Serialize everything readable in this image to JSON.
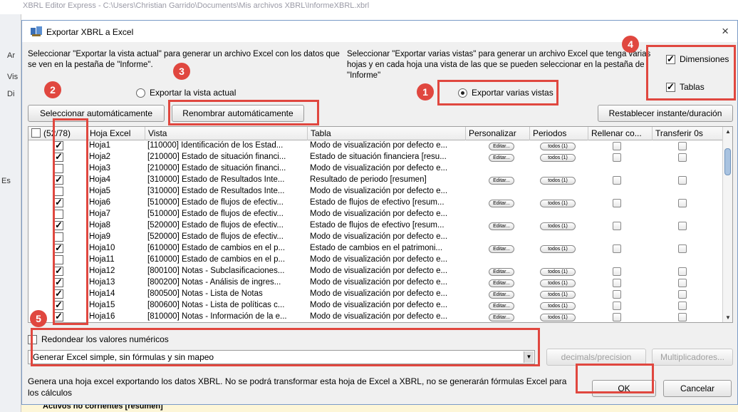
{
  "background": {
    "window_title": "XBRL Editor Express - C:\\Users\\Christian Garrido\\Documents\\Mis archivos XBRL\\InformeXBRL.xbrl",
    "left_labels": [
      "Ar",
      "Vis",
      "Di",
      "Es"
    ],
    "bottom_text": "Activos no corrientes [resumen]"
  },
  "dialog": {
    "title": "Exportar XBRL a Excel",
    "close_label": "×",
    "desc_left": "Seleccionar \"Exportar la vista actual\" para generar un archivo Excel con los datos que se ven en la pestaña de \"Informe\".",
    "desc_right": "Seleccionar \"Exportar varias vistas\" para generar un archivo Excel que tenga varias hojas y en cada hoja una vista de las que se pueden seleccionar en la pestaña de \"Informe\"",
    "radio_current": "Exportar la vista actual",
    "radio_multi": "Exportar varias vistas",
    "chk_dimensions": "Dimensiones",
    "chk_tables": "Tablas",
    "btn_auto_select": "Seleccionar automáticamente",
    "btn_auto_rename": "Renombrar automáticamente",
    "btn_reset": "Restablecer instante/duración",
    "round_label": "Redondear los valores numéricos",
    "combo_value": "Generar Excel simple, sin fórmulas y sin mapeo",
    "btn_decimals": "decimals/precision",
    "btn_multipliers": "Multiplicadores...",
    "footer_desc": "Genera una hoja excel exportando los datos XBRL. No se podrá transformar esta hoja de Excel a XBRL, no se generarán fórmulas Excel para los cálculos",
    "btn_ok": "OK",
    "btn_cancel": "Cancelar"
  },
  "table": {
    "headers": [
      "(52/78)",
      "Hoja Excel",
      "Vista",
      "Tabla",
      "Personalizar",
      "Periodos",
      "Rellenar co...",
      "Transferir 0s"
    ],
    "edit_label": "Editar...",
    "periods_label": "todos (1)",
    "rows": [
      {
        "checked": true,
        "sheet": "Hoja1",
        "view": "[110000] Identificación de los Estad...",
        "table": "Modo de visualización por defecto e...",
        "custom": true
      },
      {
        "checked": true,
        "sheet": "Hoja2",
        "view": "[210000] Estado de situación financi...",
        "table": "Estado de situación financiera [resu...",
        "custom": true
      },
      {
        "checked": false,
        "sheet": "Hoja3",
        "view": "[210000] Estado de situación financi...",
        "table": "Modo de visualización por defecto e...",
        "custom": false
      },
      {
        "checked": true,
        "sheet": "Hoja4",
        "view": "[310000] Estado de Resultados Inte...",
        "table": "Resultado de periodo [resumen]",
        "custom": true
      },
      {
        "checked": false,
        "sheet": "Hoja5",
        "view": "[310000] Estado de Resultados Inte...",
        "table": "Modo de visualización por defecto e...",
        "custom": false
      },
      {
        "checked": true,
        "sheet": "Hoja6",
        "view": "[510000] Estado de flujos de efectiv...",
        "table": "Estado de flujos de efectivo [resum...",
        "custom": true
      },
      {
        "checked": false,
        "sheet": "Hoja7",
        "view": "[510000] Estado de flujos de efectiv...",
        "table": "Modo de visualización por defecto e...",
        "custom": false
      },
      {
        "checked": true,
        "sheet": "Hoja8",
        "view": "[520000] Estado de flujos de efectiv...",
        "table": "Estado de flujos de efectivo [resum...",
        "custom": true
      },
      {
        "checked": false,
        "sheet": "Hoja9",
        "view": "[520000] Estado de flujos de efectiv...",
        "table": "Modo de visualización por defecto e...",
        "custom": false
      },
      {
        "checked": true,
        "sheet": "Hoja10",
        "view": "[610000] Estado de cambios en el p...",
        "table": "Estado de cambios en el patrimoni...",
        "custom": true
      },
      {
        "checked": false,
        "sheet": "Hoja11",
        "view": "[610000] Estado de cambios en el p...",
        "table": "Modo de visualización por defecto e...",
        "custom": false
      },
      {
        "checked": true,
        "sheet": "Hoja12",
        "view": "[800100] Notas - Subclasificaciones...",
        "table": "Modo de visualización por defecto e...",
        "custom": true
      },
      {
        "checked": true,
        "sheet": "Hoja13",
        "view": "[800200] Notas - Análisis de ingres...",
        "table": "Modo de visualización por defecto e...",
        "custom": true
      },
      {
        "checked": true,
        "sheet": "Hoja14",
        "view": "[800500] Notas - Lista de Notas",
        "table": "Modo de visualización por defecto e...",
        "custom": true
      },
      {
        "checked": true,
        "sheet": "Hoja15",
        "view": "[800600] Notas - Lista de políticas c...",
        "table": "Modo de visualización por defecto e...",
        "custom": true
      },
      {
        "checked": true,
        "sheet": "Hoja16",
        "view": "[810000] Notas - Información de la e...",
        "table": "Modo de visualización por defecto e...",
        "custom": true
      }
    ]
  },
  "annotations": [
    "1",
    "2",
    "3",
    "4",
    "5"
  ],
  "colors": {
    "annotation": "#e0473f",
    "dialog_bg": "#f0f0f0"
  }
}
